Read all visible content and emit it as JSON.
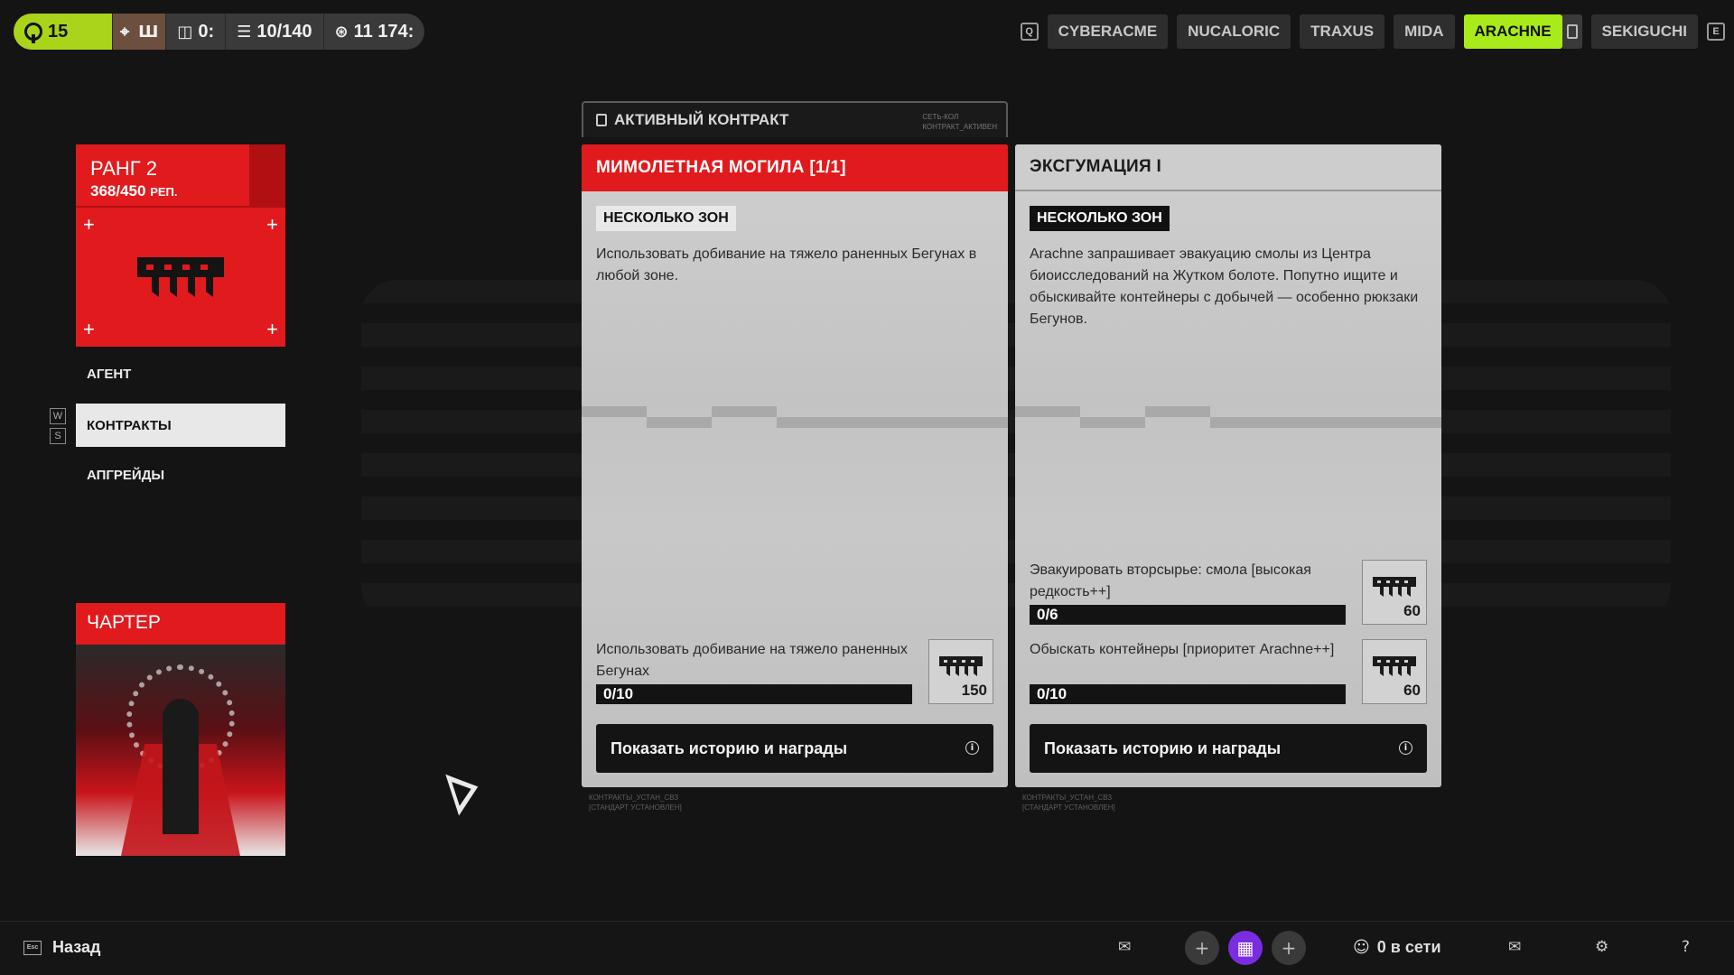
{
  "topbar": {
    "level": "15",
    "stat_bag": "0:",
    "stat_inventory": "10/140",
    "stat_credits": "11 174:",
    "faction_key_left": "Q",
    "faction_key_right": "E",
    "factions": [
      "CYBERACME",
      "NUCALORIC",
      "TRAXUS",
      "MIDA",
      "ARACHNE",
      "SEKIGUCHI"
    ],
    "active_faction": "ARACHNE"
  },
  "left": {
    "rank_title": "РАНГ 2",
    "rank_rep_value": "368/450",
    "rank_rep_unit": "РЕП.",
    "nav": [
      "АГЕНТ",
      "КОНТРАКТЫ",
      "АПГРЕЙДЫ"
    ],
    "nav_key_up": "W",
    "nav_key_down": "S",
    "charter_title": "ЧАРТЕР"
  },
  "active_contract": {
    "label": "АКТИВНЫЙ КОНТРАКТ",
    "small_line1": "СЕТЬ-КОЛ",
    "small_line2": "КОНТРАКТ_АКТИВЕН"
  },
  "cards": [
    {
      "title": "МИМОЛЕТНАЯ МОГИЛА [1/1]",
      "zone": "НЕСКОЛЬКО ЗОН",
      "description": "Использовать добивание на тяжело раненных Бегунах в любой зоне.",
      "tasks": [
        {
          "text": "Использовать добивание на тяжело раненных Бегунах",
          "progress": "0/10",
          "reward": "150"
        }
      ],
      "button": "Показать историю и награды",
      "footnote1": "КОНТРАКТЫ_УСТАН_СВЗ",
      "footnote2": "[СТАНДАРТ УСТАНОВЛЕН]"
    },
    {
      "title": "ЭКСГУМАЦИЯ I",
      "zone": "НЕСКОЛЬКО ЗОН",
      "description": "Arachne запрашивает эвакуацию смолы из Центра биоисследований на Жутком болоте. Попутно ищите и обыскивайте контейнеры с добычей — особенно рюкзаки Бегунов.",
      "tasks": [
        {
          "text": "Эвакуировать вторсырье: смола [высокая редкость++]",
          "progress": "0/6",
          "reward": "60"
        },
        {
          "text": "Обыскать контейнеры [приоритет Arachne++]",
          "progress": "0/10",
          "reward": "60"
        }
      ],
      "button": "Показать историю и награды",
      "footnote1": "КОНТРАКТЫ_УСТАН_СВЗ",
      "footnote2": "[СТАНДАРТ УСТАНОВЛЕН]"
    }
  ],
  "bottom": {
    "back_key": "Esc",
    "back_label": "Назад",
    "online": "0 в сети"
  },
  "colors": {
    "accent_red": "#e11a1d",
    "accent_green": "#a9ea1b"
  }
}
